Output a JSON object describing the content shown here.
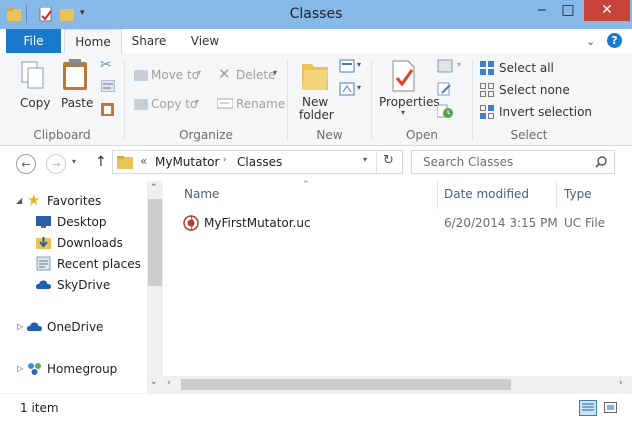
{
  "window": {
    "title": "Classes"
  },
  "ribbon": {
    "tabs": [
      {
        "label": "File"
      },
      {
        "label": "Home"
      },
      {
        "label": "Share"
      },
      {
        "label": "View"
      }
    ],
    "clipboard": {
      "group": "Clipboard",
      "copy": "Copy",
      "paste": "Paste"
    },
    "organize": {
      "group": "Organize",
      "move_to": "Move to",
      "copy_to": "Copy to",
      "delete": "Delete",
      "rename": "Rename"
    },
    "new": {
      "group": "New",
      "new_folder_line1": "New",
      "new_folder_line2": "folder"
    },
    "open": {
      "group": "Open",
      "properties": "Properties"
    },
    "select": {
      "group": "Select",
      "select_all": "Select all",
      "select_none": "Select none",
      "invert_selection": "Invert selection"
    },
    "help": "?"
  },
  "address": {
    "overflow": "«",
    "crumbs": [
      "MyMutator",
      "Classes"
    ],
    "search_placeholder": "Search Classes"
  },
  "navpane": {
    "items": [
      {
        "label": "Favorites",
        "icon": "star-icon"
      },
      {
        "label": "Desktop",
        "icon": "desktop-icon"
      },
      {
        "label": "Downloads",
        "icon": "downloads-icon"
      },
      {
        "label": "Recent places",
        "icon": "recent-places-icon"
      },
      {
        "label": "SkyDrive",
        "icon": "cloud-icon"
      },
      {
        "label": "OneDrive",
        "icon": "cloud-icon"
      },
      {
        "label": "Homegroup",
        "icon": "homegroup-icon"
      }
    ]
  },
  "filelist": {
    "columns": [
      "Name",
      "Date modified",
      "Type"
    ],
    "rows": [
      {
        "name": "MyFirstMutator.uc",
        "date": "6/20/2014 3:15 PM",
        "type": "UC File"
      }
    ]
  },
  "status": {
    "count": "1 item"
  },
  "colors": {
    "titlebar": "#86b8e8",
    "file_tab": "#1979ca",
    "close": "#c7443a",
    "cloud": "#1e5fb4"
  }
}
